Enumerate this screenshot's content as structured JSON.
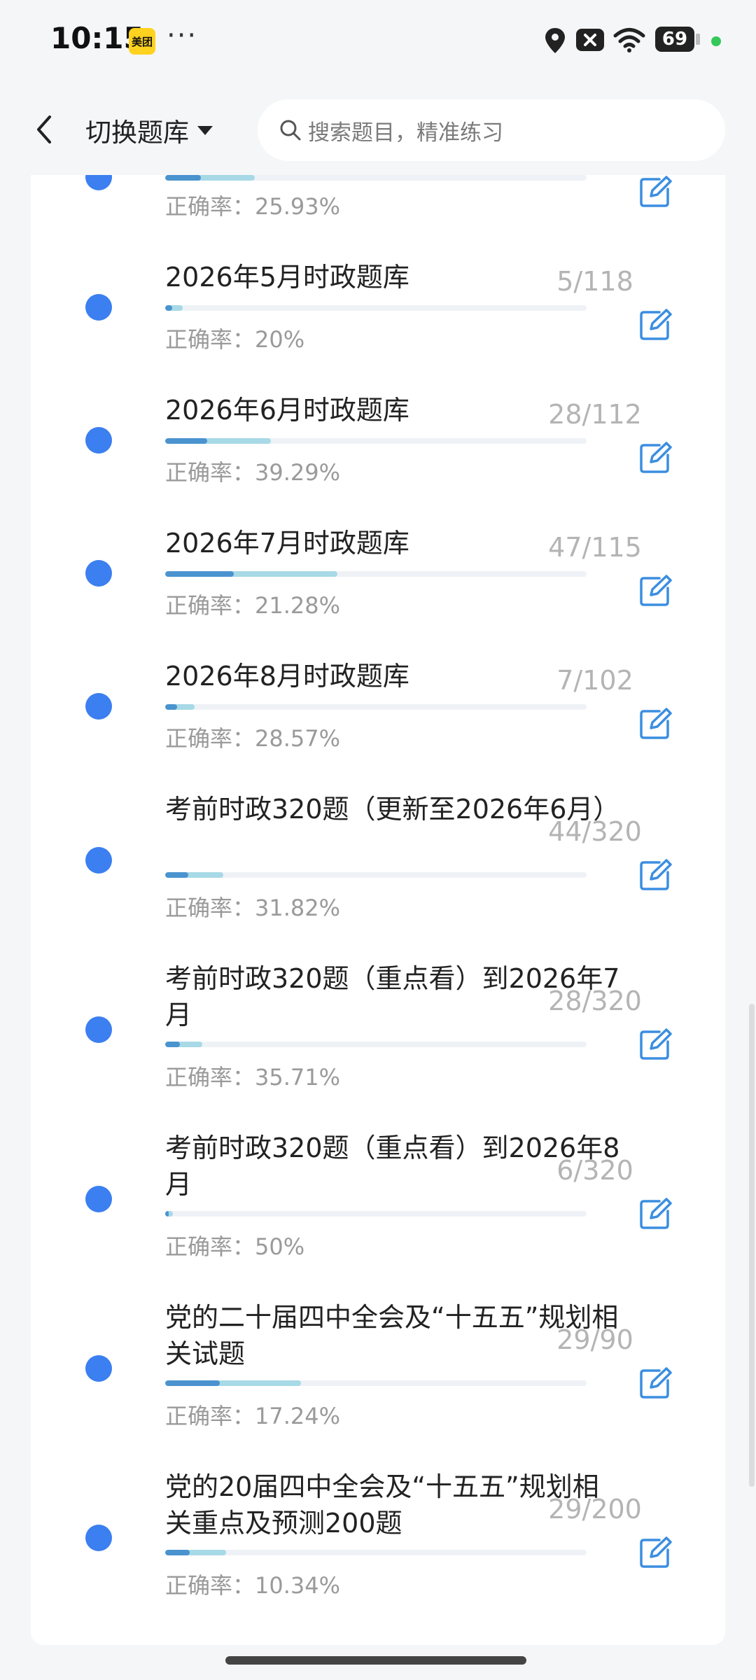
{
  "status_bar": {
    "time": "10:15",
    "app_badge": "美团",
    "more": "···",
    "battery": "69"
  },
  "header": {
    "switch_label": "切换题库",
    "search_placeholder": "搜索题目，精准练习"
  },
  "accuracy_prefix": "正确率：",
  "items": [
    {
      "title": "",
      "count": "",
      "accuracy": "25.93%",
      "progress": 0.213
    },
    {
      "title": "2026年5月时政题库",
      "count": "5/118",
      "accuracy": "20%",
      "progress": 0.042
    },
    {
      "title": "2026年6月时政题库",
      "count": "28/112",
      "accuracy": "39.29%",
      "progress": 0.25
    },
    {
      "title": "2026年7月时政题库",
      "count": "47/115",
      "accuracy": "21.28%",
      "progress": 0.409
    },
    {
      "title": "2026年8月时政题库",
      "count": "7/102",
      "accuracy": "28.57%",
      "progress": 0.069
    },
    {
      "title": "考前时政320题（更新至2026年6月）",
      "count": "44/320",
      "accuracy": "31.82%",
      "progress": 0.138
    },
    {
      "title": "考前时政320题（重点看）到2026年7月",
      "count": "28/320",
      "accuracy": "35.71%",
      "progress": 0.088
    },
    {
      "title": "考前时政320题（重点看）到2026年8月",
      "count": "6/320",
      "accuracy": "50%",
      "progress": 0.019
    },
    {
      "title": "党的二十届四中全会及“十五五”规划相关试题",
      "count": "29/90",
      "accuracy": "17.24%",
      "progress": 0.322
    },
    {
      "title": "党的20届四中全会及“十五五”规划相关重点及预测200题",
      "count": "29/200",
      "accuracy": "10.34%",
      "progress": 0.145
    }
  ],
  "colors": {
    "dot": "#3b7ff0",
    "progress_light": "#a7d9e6",
    "progress_dark": "#4a93cf",
    "edit_icon": "#3b8ee0"
  }
}
